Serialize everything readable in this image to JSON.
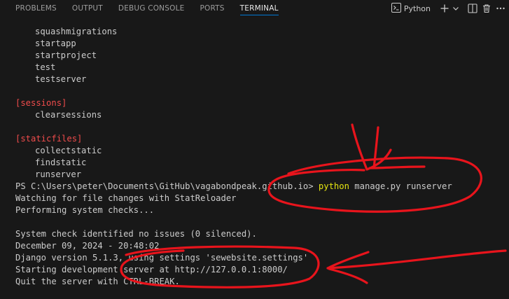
{
  "tabs": [
    {
      "label": "PROBLEMS",
      "active": false
    },
    {
      "label": "OUTPUT",
      "active": false
    },
    {
      "label": "DEBUG CONSOLE",
      "active": false
    },
    {
      "label": "PORTS",
      "active": false
    },
    {
      "label": "TERMINAL",
      "active": true
    }
  ],
  "toolbar": {
    "terminal_name": "Python",
    "icons": [
      "terminal-icon",
      "plus-icon",
      "chevron-down-icon",
      "split-icon",
      "trash-icon",
      "more-icon"
    ]
  },
  "terminal": {
    "management_commands": [
      "squashmigrations",
      "startapp",
      "startproject",
      "test",
      "testserver"
    ],
    "sessions_header": "[sessions]",
    "sessions_commands": [
      "clearsessions"
    ],
    "staticfiles_header": "[staticfiles]",
    "staticfiles_commands": [
      "collectstatic",
      "findstatic",
      "runserver"
    ],
    "prompt": "PS C:\\Users\\peter\\Documents\\GitHub\\vagabondpeak.github.io>",
    "command_name": "python",
    "command_args": "manage.py runserver",
    "output": [
      "Watching for file changes with StatReloader",
      "Performing system checks...",
      "",
      "System check identified no issues (0 silenced).",
      "December 09, 2024 - 20:48:02",
      "Django version 5.1.3, using settings 'sewebsite.settings'",
      "Starting development server at http://127.0.0.1:8000/",
      "Quit the server with CTRL-BREAK."
    ]
  },
  "colors": {
    "background": "#181818",
    "text": "#cccccc",
    "section_header": "#f14c4c",
    "command": "#e5e510",
    "active_tab_underline": "#0078d4",
    "annotation": "#e8141c"
  }
}
